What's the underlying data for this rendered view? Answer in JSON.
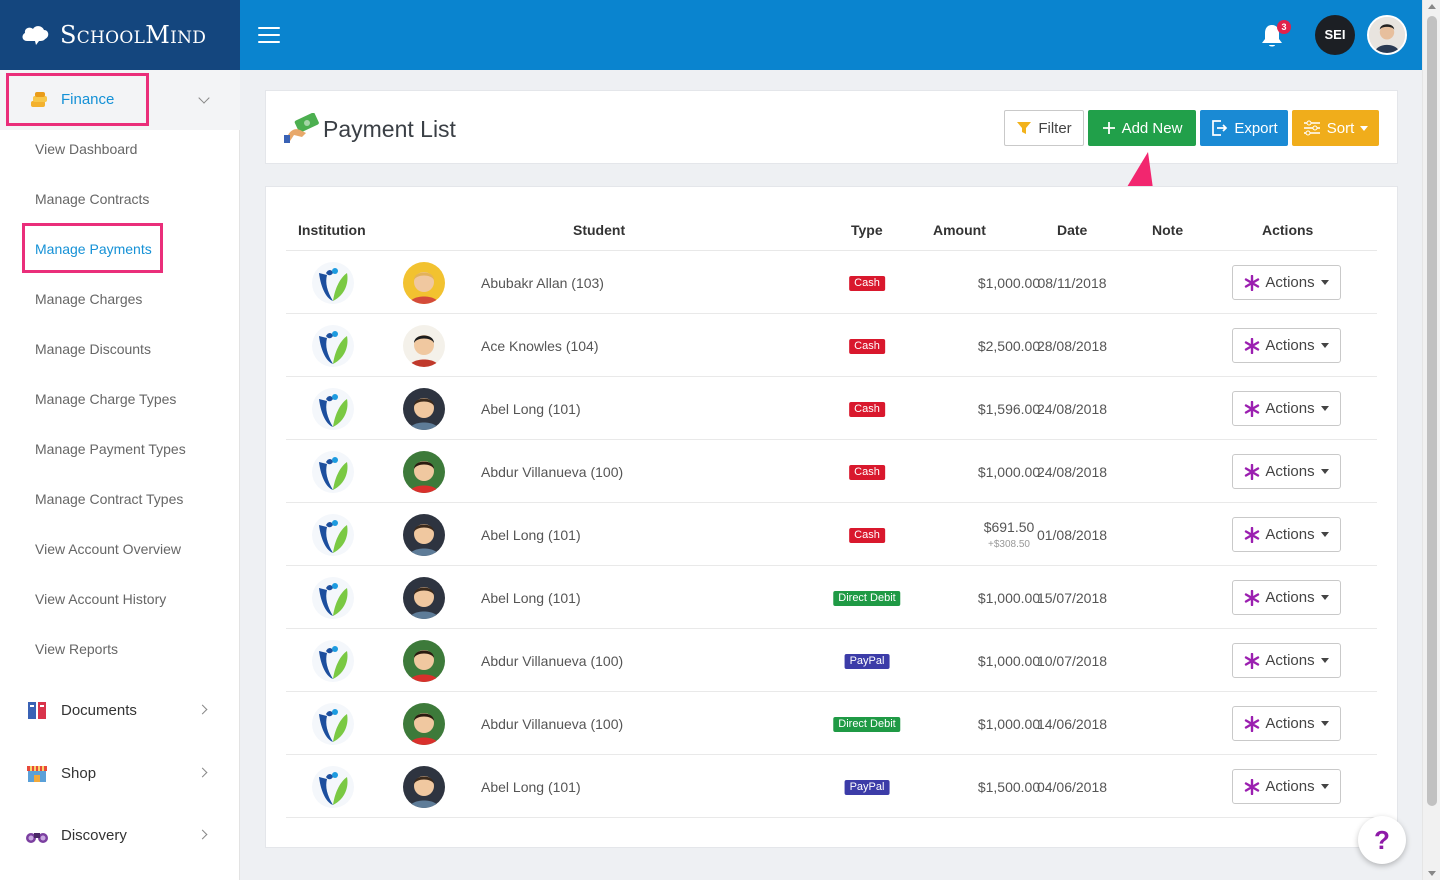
{
  "app": {
    "brand": "SchoolMind"
  },
  "header": {
    "notification_count": "3",
    "user_initials": "SEI"
  },
  "sidebar": {
    "finance_label": "Finance",
    "sub_items": [
      {
        "label": "View Dashboard"
      },
      {
        "label": "Manage Contracts"
      },
      {
        "label": "Manage Payments"
      },
      {
        "label": "Manage Charges"
      },
      {
        "label": "Manage Discounts"
      },
      {
        "label": "Manage Charge Types"
      },
      {
        "label": "Manage Payment Types"
      },
      {
        "label": "Manage Contract Types"
      },
      {
        "label": "View Account Overview"
      },
      {
        "label": "View Account History"
      },
      {
        "label": "View Reports"
      }
    ],
    "main_items": [
      {
        "label": "Documents"
      },
      {
        "label": "Shop"
      },
      {
        "label": "Discovery"
      }
    ]
  },
  "page": {
    "title": "Payment List",
    "buttons": {
      "filter": "Filter",
      "add_new": "Add New",
      "export": "Export",
      "sort": "Sort"
    }
  },
  "table": {
    "headers": {
      "institution": "Institution",
      "student": "Student",
      "type": "Type",
      "amount": "Amount",
      "date": "Date",
      "note": "Note",
      "actions": "Actions"
    },
    "action_label": "Actions",
    "rows": [
      {
        "student": "Abubakr Allan (103)",
        "type": "Cash",
        "amount": "$1,000.00",
        "amount_sub": "",
        "date": "08/11/2018"
      },
      {
        "student": "Ace Knowles (104)",
        "type": "Cash",
        "amount": "$2,500.00",
        "amount_sub": "",
        "date": "28/08/2018"
      },
      {
        "student": "Abel Long (101)",
        "type": "Cash",
        "amount": "$1,596.00",
        "amount_sub": "",
        "date": "24/08/2018"
      },
      {
        "student": "Abdur Villanueva (100)",
        "type": "Cash",
        "amount": "$1,000.00",
        "amount_sub": "",
        "date": "24/08/2018"
      },
      {
        "student": "Abel Long (101)",
        "type": "Cash",
        "amount": "$691.50",
        "amount_sub": "+$308.50",
        "date": "01/08/2018"
      },
      {
        "student": "Abel Long (101)",
        "type": "Direct Debit",
        "amount": "$1,000.00",
        "amount_sub": "",
        "date": "15/07/2018"
      },
      {
        "student": "Abdur Villanueva (100)",
        "type": "PayPal",
        "amount": "$1,000.00",
        "amount_sub": "",
        "date": "10/07/2018"
      },
      {
        "student": "Abdur Villanueva (100)",
        "type": "Direct Debit",
        "amount": "$1,000.00",
        "amount_sub": "",
        "date": "14/06/2018"
      },
      {
        "student": "Abel Long (101)",
        "type": "PayPal",
        "amount": "$1,500.00",
        "amount_sub": "",
        "date": "04/06/2018"
      }
    ]
  },
  "colors": {
    "brand_dark": "#14467e",
    "topbar_blue": "#0a84cf",
    "highlight_pink": "#ea2e7a",
    "cash": "#d9182d",
    "direct_debit": "#1f9a45",
    "paypal": "#3c3ca8",
    "add_green": "#21a04a",
    "export_blue": "#1a8ad4",
    "sort_orange": "#f0ad1b",
    "action_star": "#9b1fb0"
  },
  "help_label": "?"
}
